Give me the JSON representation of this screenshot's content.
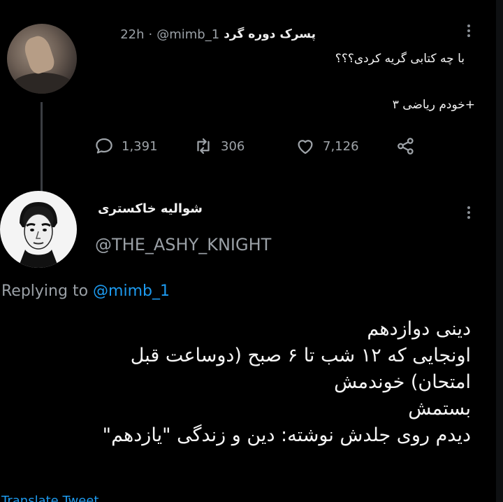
{
  "tweet1": {
    "display_name": "پسرک دوره گرد",
    "handle": "@mimb_1",
    "separator": "·",
    "time": "22h",
    "text": "با چه کتابی گریه کردی؟؟؟",
    "subtext": "+خودم ریاضی ۳",
    "actions": {
      "replies": "1,391",
      "retweets": "306",
      "likes": "7,126"
    }
  },
  "tweet2": {
    "display_name": "شوالیه خاکستری",
    "handle": "@THE_ASHY_KNIGHT",
    "replying_label": "Replying to",
    "replying_handle": "@mimb_1",
    "lines": [
      "دینی دوازدهم",
      "اونجایی که ۱۲ شب تا ۶ صبح (دوساعت قبل",
      "امتحان) خوندمش",
      "بستمش",
      "دیدم روی جلدش نوشته: دین و زندگی \"یازدهم\""
    ],
    "translate_label": "Translate Tweet"
  },
  "icons": [
    "reply-icon",
    "retweet-icon",
    "like-icon",
    "share-icon",
    "more-icon"
  ],
  "colors": {
    "background": "#000000",
    "text": "#e8e8ea",
    "muted": "#9aa0a6",
    "link": "#1d9bf0"
  }
}
